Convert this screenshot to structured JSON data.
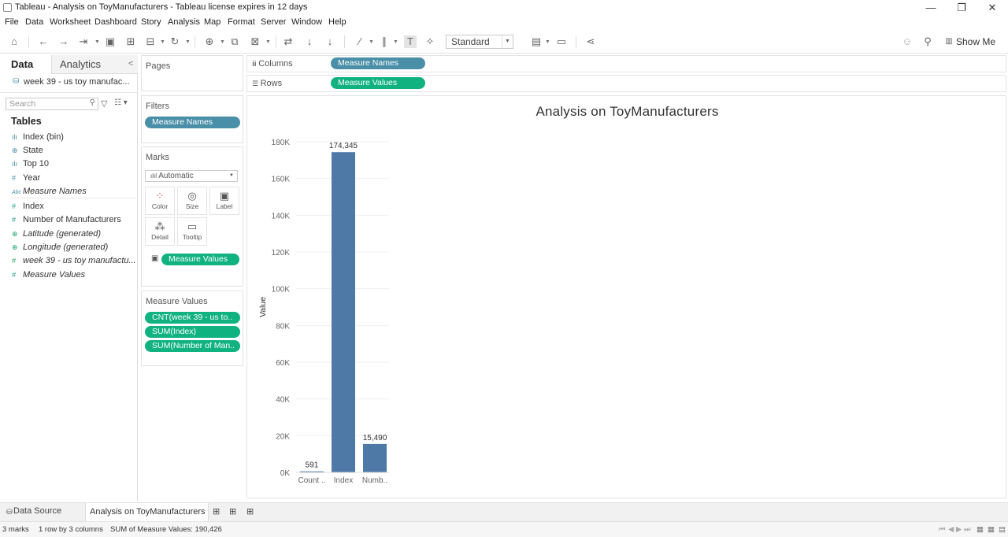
{
  "window": {
    "title": "Tableau - Analysis on ToyManufacturers - Tableau license expires in 12 days",
    "minimize": "—",
    "restore": "❐",
    "close": "✕"
  },
  "menu": [
    "File",
    "Data",
    "Worksheet",
    "Dashboard",
    "Story",
    "Analysis",
    "Map",
    "Format",
    "Server",
    "Window",
    "Help"
  ],
  "toolbar": {
    "fit_select": "Standard",
    "show_me": "Show Me"
  },
  "data_pane": {
    "tab_data": "Data",
    "tab_analytics": "Analytics",
    "collapse": "<",
    "datasource": "week 39 - us toy manufac...",
    "search_placeholder": "Search",
    "tables_heading": "Tables",
    "fields": [
      {
        "label": "Index (bin)",
        "icon": "ılı",
        "type": "dim",
        "italic": false
      },
      {
        "label": "State",
        "icon": "⊕",
        "type": "dim",
        "italic": false
      },
      {
        "label": "Top 10",
        "icon": "ılı",
        "type": "dim",
        "italic": false
      },
      {
        "label": "Year",
        "icon": "#",
        "type": "dim",
        "italic": false
      },
      {
        "label": "Measure Names",
        "icon": "Abc",
        "type": "dim",
        "italic": true
      },
      {
        "label": "Index",
        "icon": "#",
        "type": "mea",
        "italic": false
      },
      {
        "label": "Number of Manufacturers",
        "icon": "#",
        "type": "mea",
        "italic": false
      },
      {
        "label": "Latitude (generated)",
        "icon": "⊕",
        "type": "mea",
        "italic": true
      },
      {
        "label": "Longitude (generated)",
        "icon": "⊕",
        "type": "mea",
        "italic": true
      },
      {
        "label": "week 39 - us toy manufactu...",
        "icon": "#",
        "type": "mea",
        "italic": true
      },
      {
        "label": "Measure Values",
        "icon": "#",
        "type": "mea",
        "italic": true
      }
    ]
  },
  "cards": {
    "pages": "Pages",
    "filters": "Filters",
    "filters_pill": "Measure Names",
    "marks": "Marks",
    "mark_type": "Automatic",
    "mark_buttons": [
      "Color",
      "Size",
      "Label",
      "Detail",
      "Tooltip"
    ],
    "marks_pill": "Measure Values",
    "measure_values_title": "Measure Values",
    "measure_values_pills": [
      "CNT(week 39 - us to..",
      "SUM(Index)",
      "SUM(Number of Man.."
    ]
  },
  "shelves": {
    "columns_label": "Columns",
    "columns_pill": "Measure Names",
    "rows_label": "Rows",
    "rows_pill": "Measure Values"
  },
  "chart_data": {
    "type": "bar",
    "title": "Analysis on ToyManufacturers",
    "categories": [
      "Count ..",
      "Index",
      "Numb.."
    ],
    "values": [
      591,
      174345,
      15490
    ],
    "value_labels": [
      "591",
      "174,345",
      "15,490"
    ],
    "ylabel": "Value",
    "xlabel": "",
    "ylim": [
      0,
      180000
    ],
    "yticks": [
      0,
      20000,
      40000,
      60000,
      80000,
      100000,
      120000,
      140000,
      160000,
      180000
    ],
    "ytick_labels": [
      "0K",
      "20K",
      "40K",
      "60K",
      "80K",
      "100K",
      "120K",
      "140K",
      "160K",
      "180K"
    ],
    "bar_color": "#4e79a7",
    "grid": true
  },
  "tabs": {
    "data_source": "Data Source",
    "sheet": "Analysis on ToyManufacturers"
  },
  "status": {
    "marks": "3 marks",
    "rows_cols": "1 row by 3 columns",
    "sum": "SUM of Measure Values: 190,426"
  }
}
